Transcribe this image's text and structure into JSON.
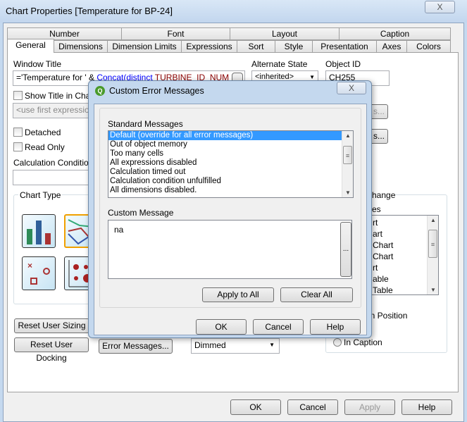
{
  "window": {
    "title": "Chart Properties [Temperature for BP-24]",
    "close": "X"
  },
  "tabs_row1": [
    "Number",
    "Font",
    "Layout",
    "Caption"
  ],
  "tabs_row2": [
    "General",
    "Dimensions",
    "Dimension Limits",
    "Expressions",
    "Sort",
    "Style",
    "Presentation",
    "Axes",
    "Colors"
  ],
  "general": {
    "window_title_label": "Window Title",
    "window_title_prefix": "='Temperature for ' & ",
    "window_title_func": "Concat(distinct ",
    "window_title_field": "TURBINE_ID_NUM",
    "alternate_state_label": "Alternate State",
    "alternate_state_value": "<inherited>",
    "object_id_label": "Object ID",
    "object_id_value": "CH255",
    "show_title_label": "Show Title in Chart",
    "title_placeholder": "<use first expressio",
    "right_btn1_fragment": "s...",
    "right_btn2_fragment": "s...",
    "detached_label": "Detached",
    "read_only_label": "Read Only",
    "calc_condition_label": "Calculation Condition",
    "chart_type_label": "Chart Type",
    "quick_change_fragment": "hange",
    "quick_change_sub_fragment": "es",
    "quick_list_fragments": [
      "rt",
      "art",
      "Chart",
      "Chart",
      "rt",
      "able",
      "Table"
    ],
    "caption_position_fragment": "on Position",
    "in_caption_fragment": "In Caption",
    "reset_sizing": "Reset User Sizing",
    "reset_docking": "Reset User Docking",
    "error_messages": "Error Messages...",
    "dimmed_value": "Dimmed"
  },
  "footer": {
    "ok": "OK",
    "cancel": "Cancel",
    "apply": "Apply",
    "help": "Help"
  },
  "dialog": {
    "title": "Custom Error Messages",
    "close": "X",
    "standard_label": "Standard Messages",
    "messages": [
      "Default (override for all error messages)",
      "Out of object memory",
      "Too many cells",
      "All expressions disabled",
      "Calculation timed out",
      "Calculation condition unfulfilled",
      "All dimensions disabled."
    ],
    "selected_index": 0,
    "custom_label": "Custom Message",
    "custom_value": "na",
    "ellipsis": "...",
    "apply_all": "Apply to All",
    "clear_all": "Clear All",
    "ok": "OK",
    "cancel": "Cancel",
    "help": "Help"
  },
  "colors": {
    "selection": "#3399ff",
    "func": "#0000ff",
    "field": "#8b0000",
    "accent_border": "#f0a000"
  }
}
